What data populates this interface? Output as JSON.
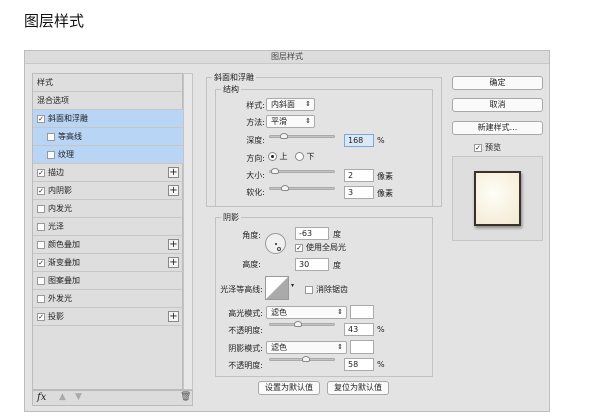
{
  "page_title": "图层样式",
  "dialog": {
    "title": "图层样式",
    "styles_list": [
      {
        "label": "样式",
        "checkbox": false,
        "checked": false,
        "indent": false,
        "selected": false,
        "plus": false
      },
      {
        "label": "混合选项",
        "checkbox": false,
        "checked": false,
        "indent": false,
        "selected": false,
        "plus": false
      },
      {
        "label": "斜面和浮雕",
        "checkbox": true,
        "checked": true,
        "indent": false,
        "selected": true,
        "plus": false
      },
      {
        "label": "等高线",
        "checkbox": true,
        "checked": false,
        "indent": true,
        "selected": true,
        "plus": false
      },
      {
        "label": "纹理",
        "checkbox": true,
        "checked": false,
        "indent": true,
        "selected": true,
        "plus": false
      },
      {
        "label": "描边",
        "checkbox": true,
        "checked": true,
        "indent": false,
        "selected": false,
        "plus": true
      },
      {
        "label": "内阴影",
        "checkbox": true,
        "checked": true,
        "indent": false,
        "selected": false,
        "plus": true
      },
      {
        "label": "内发光",
        "checkbox": true,
        "checked": false,
        "indent": false,
        "selected": false,
        "plus": false
      },
      {
        "label": "光泽",
        "checkbox": true,
        "checked": false,
        "indent": false,
        "selected": false,
        "plus": false
      },
      {
        "label": "颜色叠加",
        "checkbox": true,
        "checked": false,
        "indent": false,
        "selected": false,
        "plus": true
      },
      {
        "label": "渐变叠加",
        "checkbox": true,
        "checked": true,
        "indent": false,
        "selected": false,
        "plus": true
      },
      {
        "label": "图案叠加",
        "checkbox": true,
        "checked": false,
        "indent": false,
        "selected": false,
        "plus": false
      },
      {
        "label": "外发光",
        "checkbox": true,
        "checked": false,
        "indent": false,
        "selected": false,
        "plus": false
      },
      {
        "label": "投影",
        "checkbox": true,
        "checked": true,
        "indent": false,
        "selected": false,
        "plus": true
      }
    ],
    "bottom_bar": {
      "fx": "fx"
    },
    "bevel": {
      "group_title": "斜面和浮雕",
      "structure_title": "结构",
      "style_label": "样式:",
      "style_value": "内斜面",
      "technique_label": "方法:",
      "technique_value": "平滑",
      "depth_label": "深度:",
      "depth_value": "168",
      "depth_unit": "%",
      "depth_slider": 0.17,
      "direction_label": "方向:",
      "direction_up": "上",
      "direction_down": "下",
      "direction_selected": "上",
      "size_label": "大小:",
      "size_value": "2",
      "size_unit": "像素",
      "size_slider": 0.01,
      "soften_label": "软化:",
      "soften_value": "3",
      "soften_unit": "像素",
      "soften_slider": 0.2
    },
    "shading": {
      "group_title": "阴影",
      "angle_label": "角度:",
      "angle_value": "-63",
      "angle_unit": "度",
      "global_light_label": "使用全局光",
      "global_light_checked": true,
      "altitude_label": "高度:",
      "altitude_value": "30",
      "altitude_unit": "度",
      "gloss_contour_label": "光泽等高线:",
      "anti_alias_label": "消除锯齿",
      "anti_alias_checked": false,
      "highlight_mode_label": "高光模式:",
      "highlight_mode_value": "滤色",
      "highlight_opacity_label": "不透明度:",
      "highlight_opacity_value": "43",
      "highlight_opacity_unit": "%",
      "highlight_opacity": 0.43,
      "shadow_mode_label": "阴影模式:",
      "shadow_mode_value": "滤色",
      "shadow_opacity_label": "不透明度:",
      "shadow_opacity_value": "58",
      "shadow_opacity_unit": "%",
      "shadow_opacity": 0.58
    },
    "make_default": "设置为默认值",
    "reset_default": "复位为默认值",
    "ok": "确定",
    "cancel": "取消",
    "new_style": "新建样式...",
    "preview_label": "预览",
    "preview_checked": true
  }
}
